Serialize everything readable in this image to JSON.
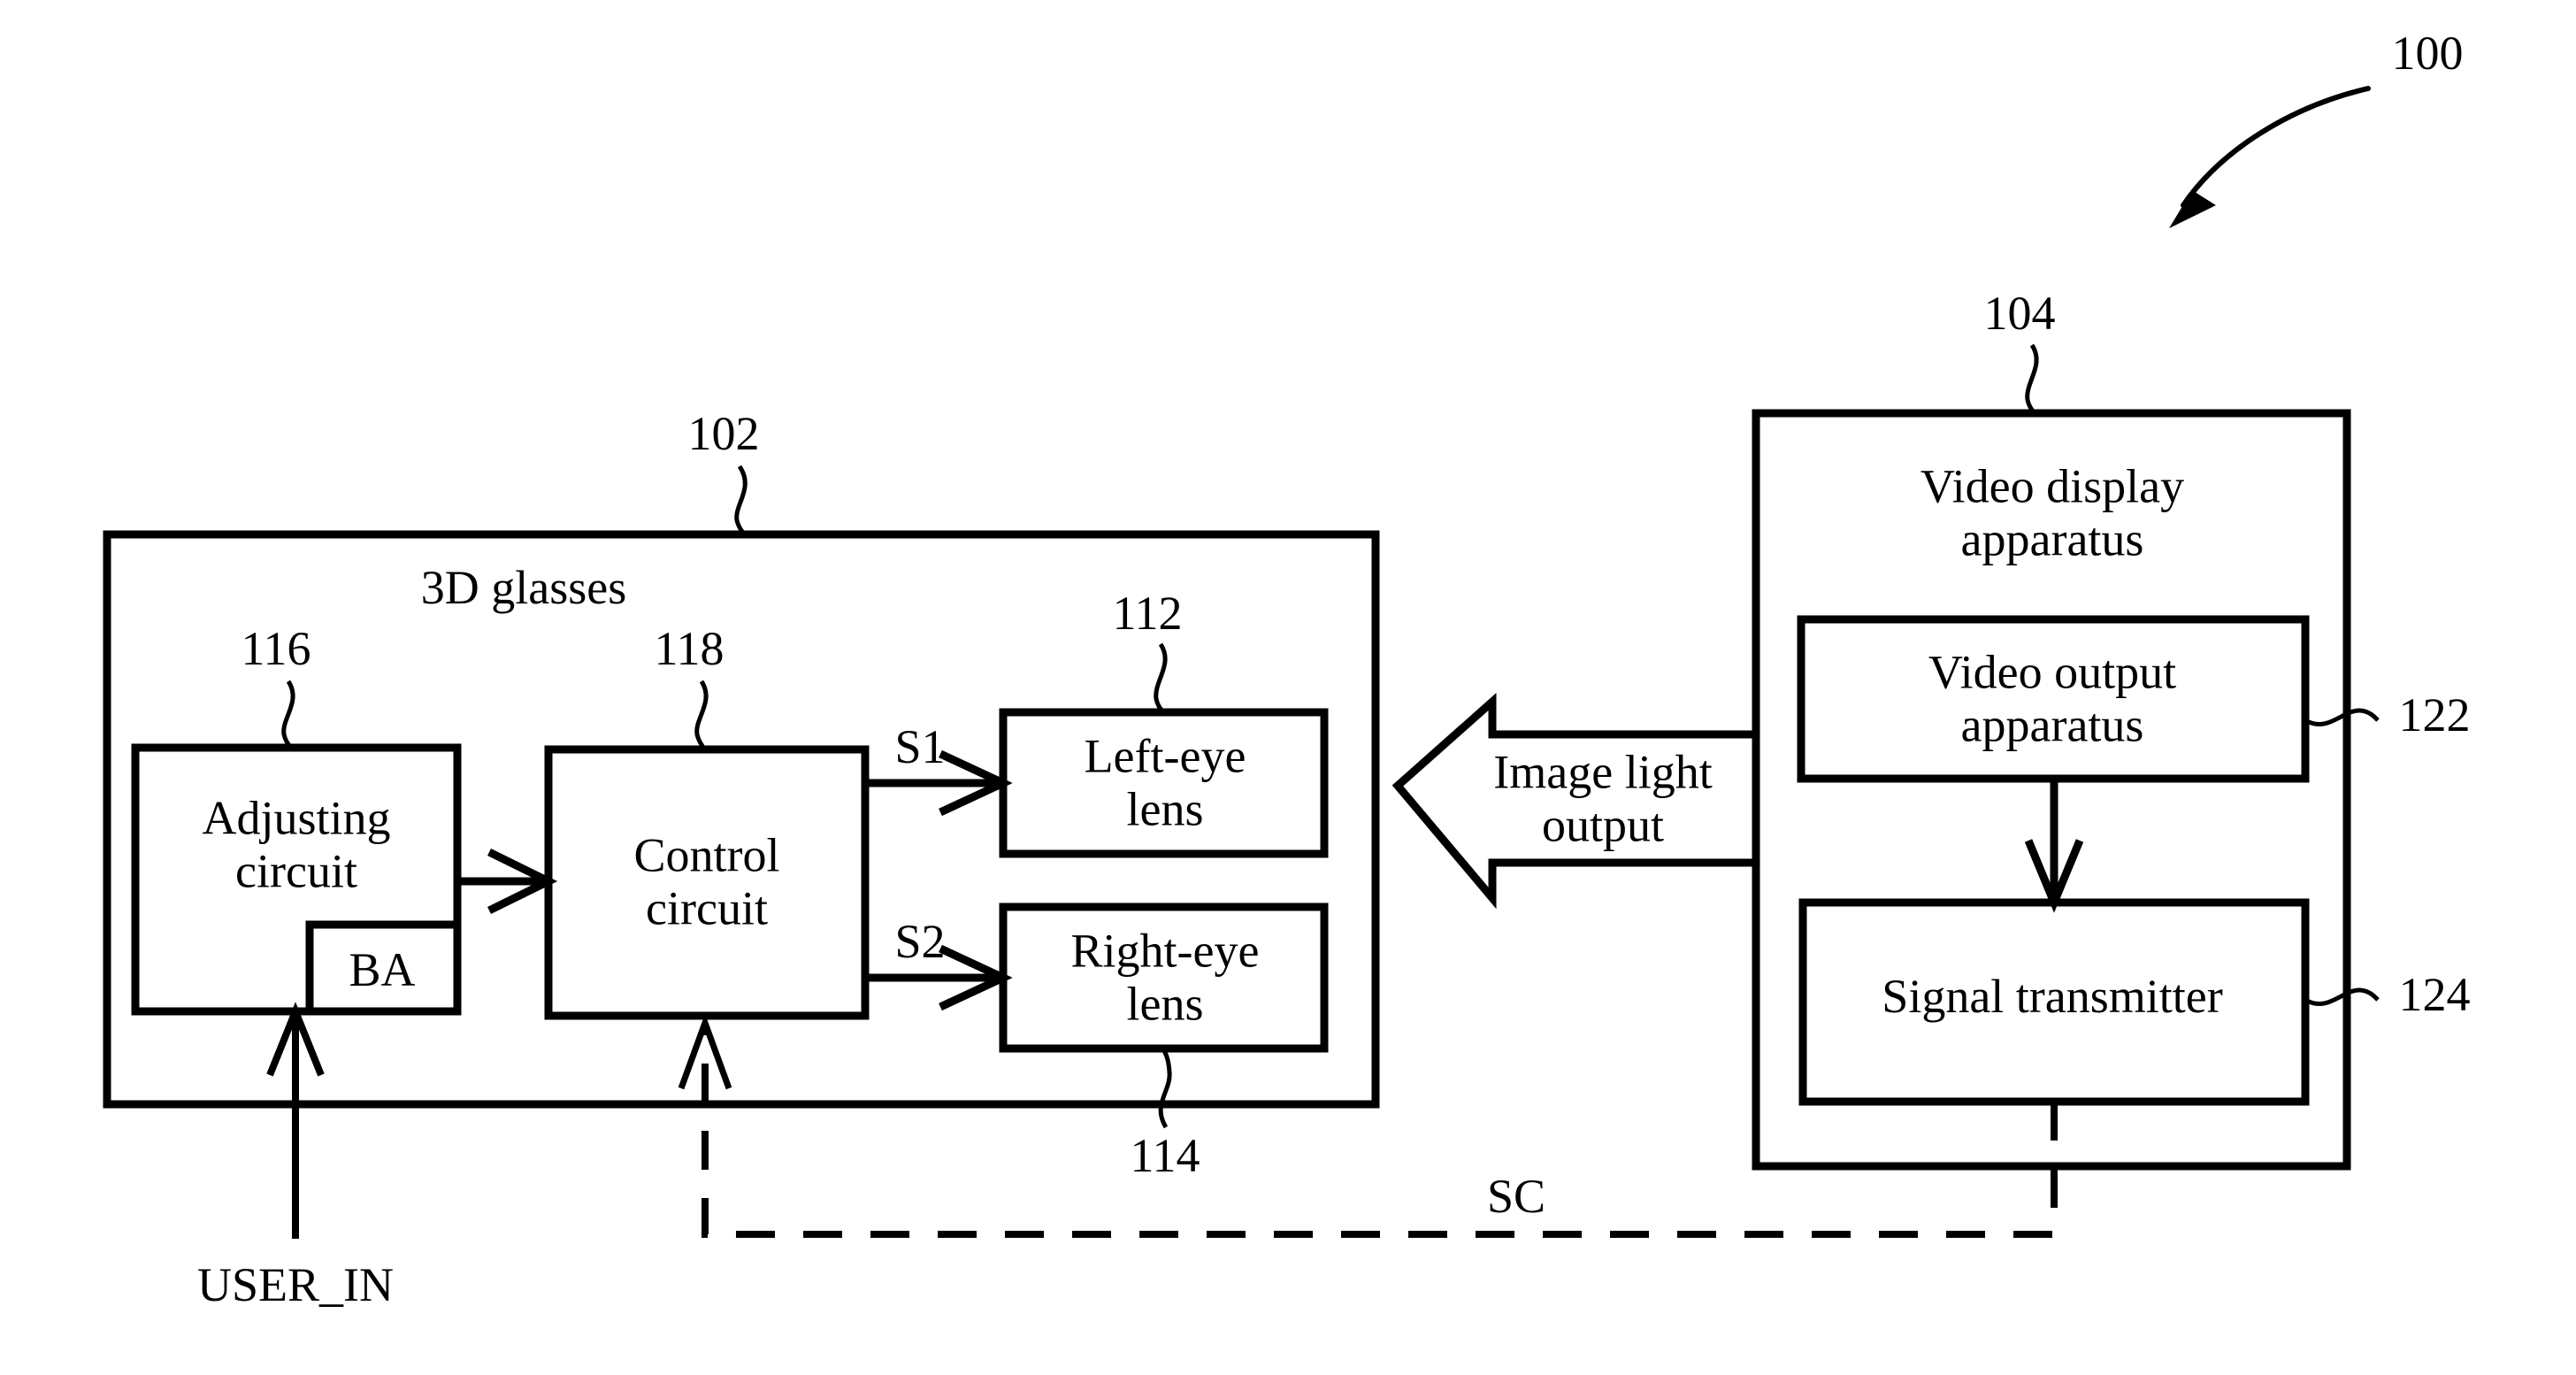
{
  "figure": {
    "system_ref": "100",
    "glasses": {
      "ref": "102",
      "title": "3D glasses",
      "adjusting_circuit": {
        "ref": "116",
        "label": "Adjusting\ncircuit"
      },
      "ba_block": {
        "label": "BA"
      },
      "control_circuit": {
        "ref": "118",
        "label": "Control\ncircuit"
      },
      "left_eye_lens": {
        "ref": "112",
        "label": "Left-eye\nlens"
      },
      "right_eye_lens": {
        "ref": "114",
        "label": "Right-eye\nlens"
      },
      "signal_s1": "S1",
      "signal_s2": "S2",
      "user_input": "USER_IN"
    },
    "display": {
      "ref": "104",
      "title": "Video display\napparatus",
      "video_output_apparatus": {
        "ref": "122",
        "label": "Video output\napparatus"
      },
      "signal_transmitter": {
        "ref": "124",
        "label": "Signal transmitter"
      }
    },
    "image_light_arrow": {
      "label": "Image light\noutput"
    },
    "sc_signal": "SC",
    "colors": {
      "stroke": "#000000",
      "background": "#ffffff"
    }
  }
}
